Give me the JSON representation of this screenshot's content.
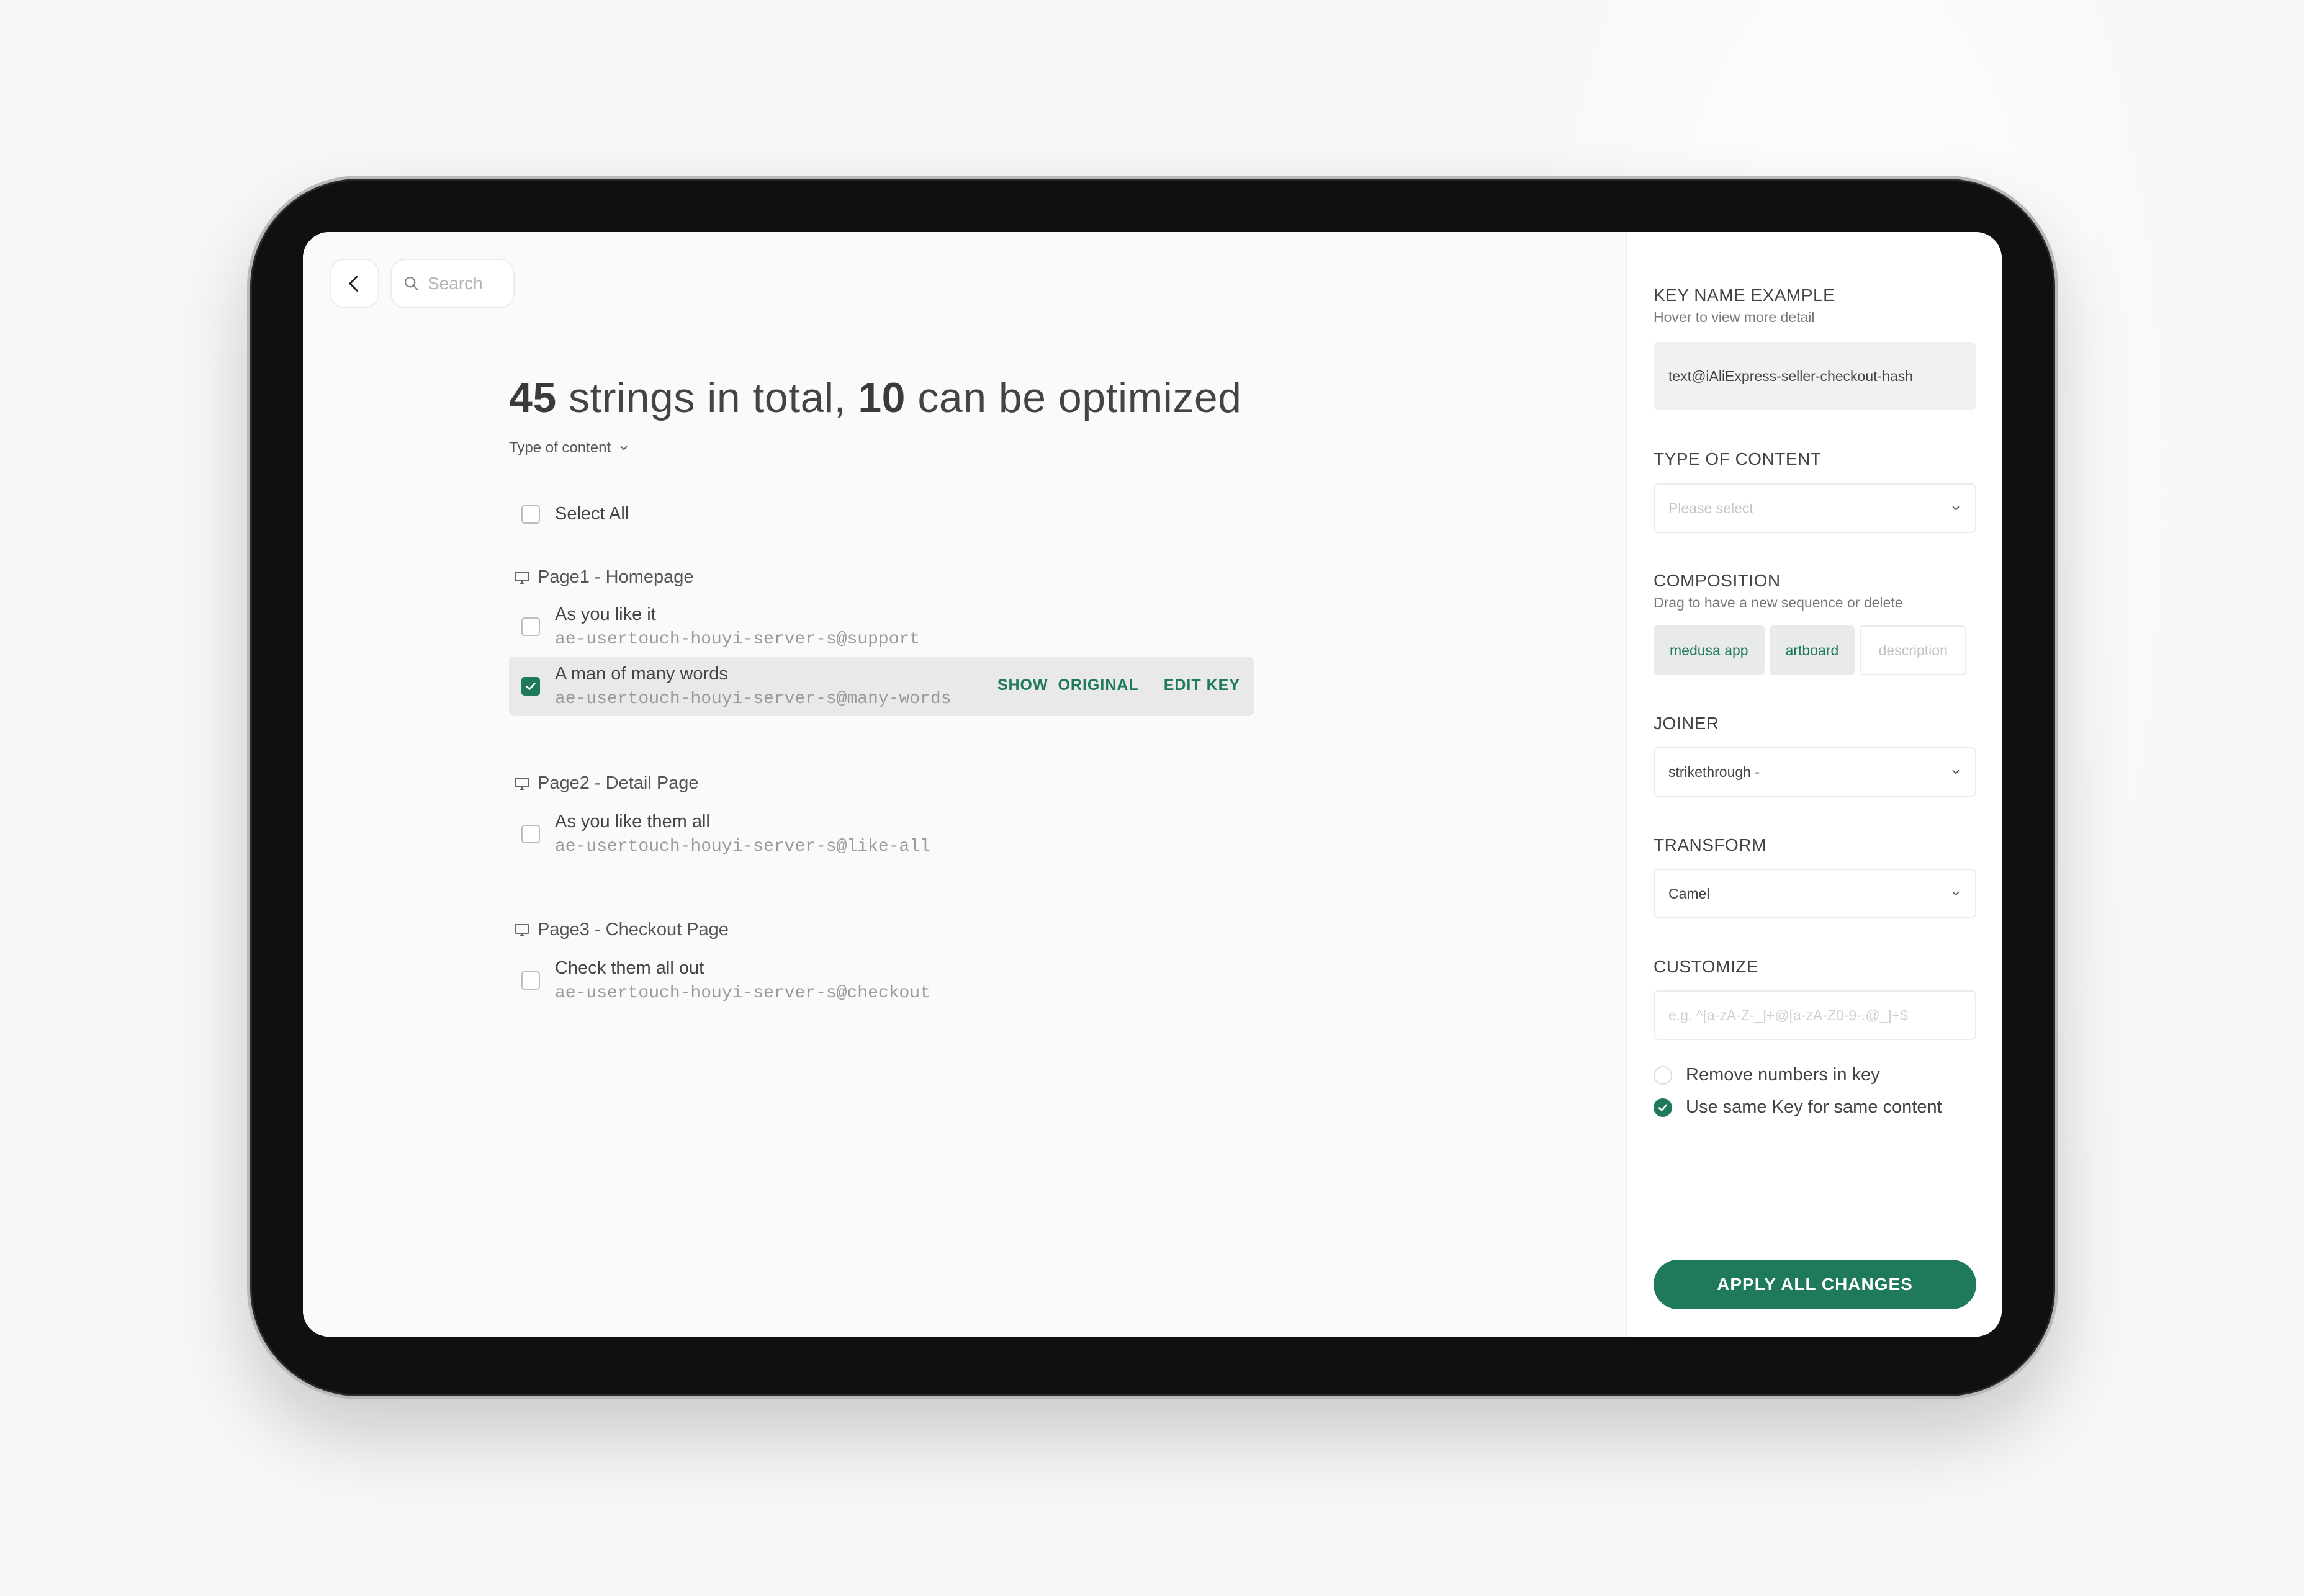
{
  "header": {
    "search_placeholder": "Search"
  },
  "summary": {
    "total": "45",
    "total_suffix": " strings in total, ",
    "optimizable": "10",
    "optimizable_suffix": " can be optimized"
  },
  "filter": {
    "type_label": "Type of content"
  },
  "select_all_label": "Select All",
  "groups": [
    {
      "title": "Page1 - Homepage",
      "items": [
        {
          "label": "As you like it",
          "key": "ae-usertouch-houyi-server-s@support",
          "checked": false
        },
        {
          "label": "A man of many words",
          "key": "ae-usertouch-houyi-server-s@many-words",
          "checked": true
        }
      ]
    },
    {
      "title": "Page2 - Detail Page",
      "items": [
        {
          "label": "As you like them all",
          "key": "ae-usertouch-houyi-server-s@like-all",
          "checked": false
        }
      ]
    },
    {
      "title": "Page3 - Checkout Page",
      "items": [
        {
          "label": "Check them all out",
          "key": "ae-usertouch-houyi-server-s@checkout",
          "checked": false
        }
      ]
    }
  ],
  "row_actions": {
    "show_original": "SHOW  ORIGINAL",
    "edit_key": "EDIT KEY"
  },
  "panel": {
    "key_name_title": "KEY NAME EXAMPLE",
    "key_name_sub": "Hover to view more detail",
    "key_name_example": "text@iAliExpress-seller-checkout-hash",
    "type_title": "TYPE OF CONTENT",
    "type_placeholder": "Please select",
    "composition_title": "COMPOSITION",
    "composition_sub": "Drag to have a new sequence or delete",
    "chips": [
      "medusa app",
      "artboard"
    ],
    "chip_placeholder": "description",
    "joiner_title": "JOINER",
    "joiner_value": "strikethrough -",
    "transform_title": "TRANSFORM",
    "transform_value": "Camel",
    "customize_title": "CUSTOMIZE",
    "customize_placeholder": "e.g. ^[a-zA-Z-_]+@[a-zA-Z0-9-.@_]+$",
    "option_remove_numbers": "Remove numbers in key",
    "option_same_key": "Use same Key for same content",
    "apply_label": "APPLY ALL CHANGES"
  },
  "colors": {
    "accent": "#1f7a59",
    "device": "#101010",
    "screen_bg": "#fafafa"
  }
}
